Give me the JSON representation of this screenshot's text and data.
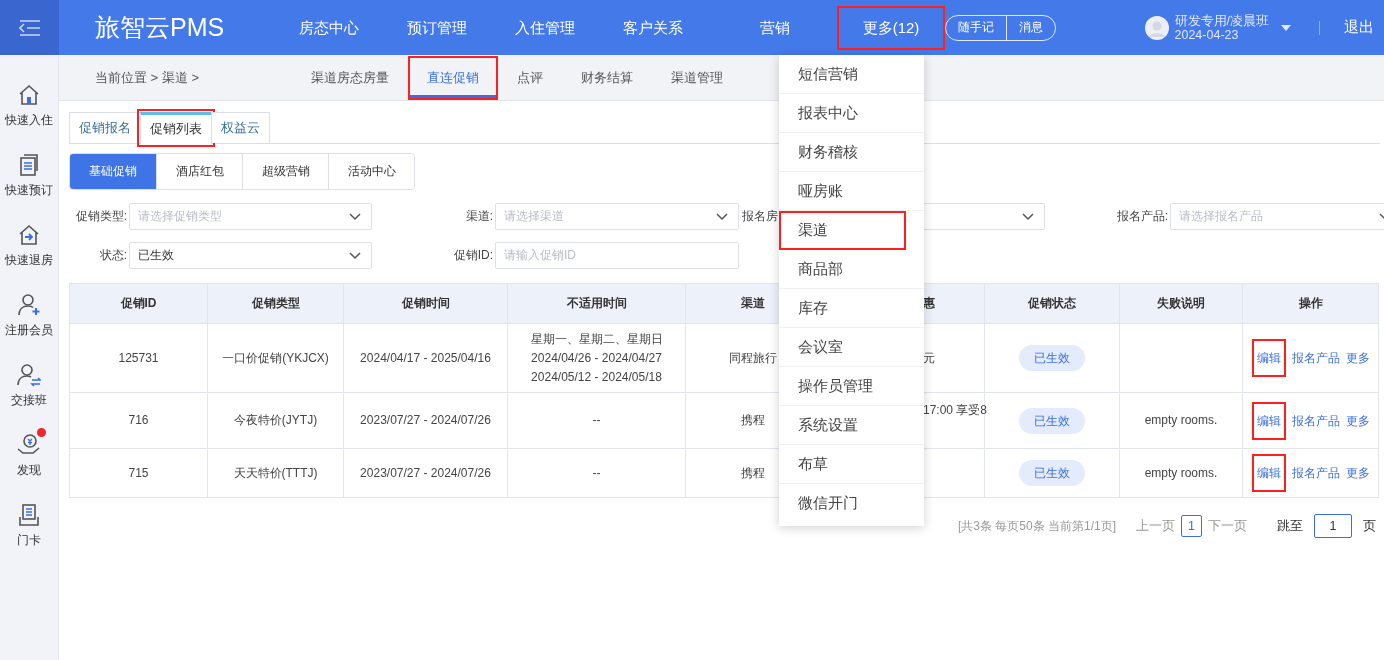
{
  "header": {
    "logo": "旅智云PMS",
    "nav": [
      {
        "label": "房态中心",
        "highlighted": false
      },
      {
        "label": "预订管理",
        "highlighted": false
      },
      {
        "label": "入住管理",
        "highlighted": false
      },
      {
        "label": "客户关系",
        "highlighted": false
      },
      {
        "label": "营销",
        "highlighted": false
      },
      {
        "label": "更多(12)",
        "highlighted": true
      }
    ],
    "quick_buttons": [
      "随手记",
      "消息"
    ],
    "user": {
      "name": "研发专用/凌晨班",
      "date": "2024-04-23"
    },
    "logout": "退出"
  },
  "sidebar": {
    "items": [
      {
        "label": "快速入住",
        "kind": "home",
        "badge": false
      },
      {
        "label": "快速预订",
        "kind": "doc",
        "badge": false
      },
      {
        "label": "快速退房",
        "kind": "exit",
        "badge": false
      },
      {
        "label": "注册会员",
        "kind": "user-add",
        "badge": false
      },
      {
        "label": "交接班",
        "kind": "user-swap",
        "badge": false
      },
      {
        "label": "发现",
        "kind": "coin",
        "badge": true
      },
      {
        "label": "门卡",
        "kind": "card",
        "badge": false
      }
    ]
  },
  "breadcrumb": "当前位置 > 渠道 >",
  "subtabs": [
    {
      "label": "渠道房态房量",
      "selected": false,
      "highlighted": false
    },
    {
      "label": "直连促销",
      "selected": true,
      "highlighted": true
    },
    {
      "label": "点评",
      "selected": false,
      "highlighted": false
    },
    {
      "label": "财务结算",
      "selected": false,
      "highlighted": false
    },
    {
      "label": "渠道管理",
      "selected": false,
      "highlighted": false
    }
  ],
  "tabs": [
    {
      "label": "促销报名",
      "selected": false,
      "highlighted": false
    },
    {
      "label": "促销列表",
      "selected": true,
      "highlighted": true
    },
    {
      "label": "权益云",
      "selected": false,
      "highlighted": false
    }
  ],
  "segments": [
    {
      "label": "基础促销",
      "selected": true
    },
    {
      "label": "酒店红包",
      "selected": false
    },
    {
      "label": "超级营销",
      "selected": false
    },
    {
      "label": "活动中心",
      "selected": false
    }
  ],
  "filters": [
    {
      "label": "促销类型:",
      "placeholder": "请选择促销类型",
      "kind": "select"
    },
    {
      "label": "渠道:",
      "placeholder": "请选择渠道",
      "kind": "select"
    },
    {
      "label": "报名房",
      "kind": "select"
    },
    {
      "label": "报名产品:",
      "placeholder": "请选择报名产品",
      "kind": "select"
    },
    {
      "label": "状态:",
      "value": "已生效",
      "kind": "select"
    },
    {
      "label": "促销ID:",
      "placeholder": "请输入促销ID",
      "kind": "input"
    }
  ],
  "table": {
    "columns": [
      "促销ID",
      "促销类型",
      "促销时间",
      "不适用时间",
      "渠道",
      "惠",
      "促销状态",
      "失败说明",
      "操作"
    ],
    "rows": [
      {
        "id": "125731",
        "type": "一口价促销(YKJCX)",
        "period": "2024/04/17 - 2025/04/16",
        "excluded": [
          "星期一、星期二、星期日",
          "2024/04/26 - 2024/04/27",
          "2024/05/12 - 2024/05/18"
        ],
        "channel": "同程旅行",
        "discount": "元",
        "status": "已生效",
        "failure": "",
        "edit_highlighted": true,
        "actions": [
          "编辑",
          "报名产品",
          "更多"
        ]
      },
      {
        "id": "716",
        "type": "今夜特价(JYTJ)",
        "period": "2023/07/27 - 2024/07/26",
        "excluded": [
          "--"
        ],
        "channel": "携程",
        "discount": "17:00 享受8",
        "status": "已生效",
        "failure": "empty rooms.",
        "edit_highlighted": true,
        "actions": [
          "编辑",
          "报名产品",
          "更多"
        ]
      },
      {
        "id": "715",
        "type": "天天特价(TTTJ)",
        "period": "2023/07/27 - 2024/07/26",
        "excluded": [
          "--"
        ],
        "channel": "携程",
        "discount": "",
        "status": "已生效",
        "failure": "empty rooms.",
        "edit_highlighted": true,
        "actions": [
          "编辑",
          "报名产品",
          "更多"
        ]
      }
    ]
  },
  "pagination": {
    "summary": "[共3条 每页50条 当前第1/1页]",
    "prev": "上一页",
    "pages": [
      {
        "label": "1",
        "selected": true
      }
    ],
    "next": "下一页",
    "jump_label": "跳至",
    "jump_value": "1",
    "jump_unit": "页"
  },
  "dropdown": {
    "items": [
      {
        "label": "短信营销",
        "highlighted": false
      },
      {
        "label": "报表中心",
        "highlighted": false
      },
      {
        "label": "财务稽核",
        "highlighted": false
      },
      {
        "label": "哑房账",
        "highlighted": false
      },
      {
        "label": "渠道",
        "highlighted": true
      },
      {
        "label": "商品部",
        "highlighted": false
      },
      {
        "label": "库存",
        "highlighted": false
      },
      {
        "label": "会议室",
        "highlighted": false
      },
      {
        "label": "操作员管理",
        "highlighted": false
      },
      {
        "label": "系统设置",
        "highlighted": false
      },
      {
        "label": "布草",
        "highlighted": false
      },
      {
        "label": "微信开门",
        "highlighted": false
      }
    ]
  }
}
